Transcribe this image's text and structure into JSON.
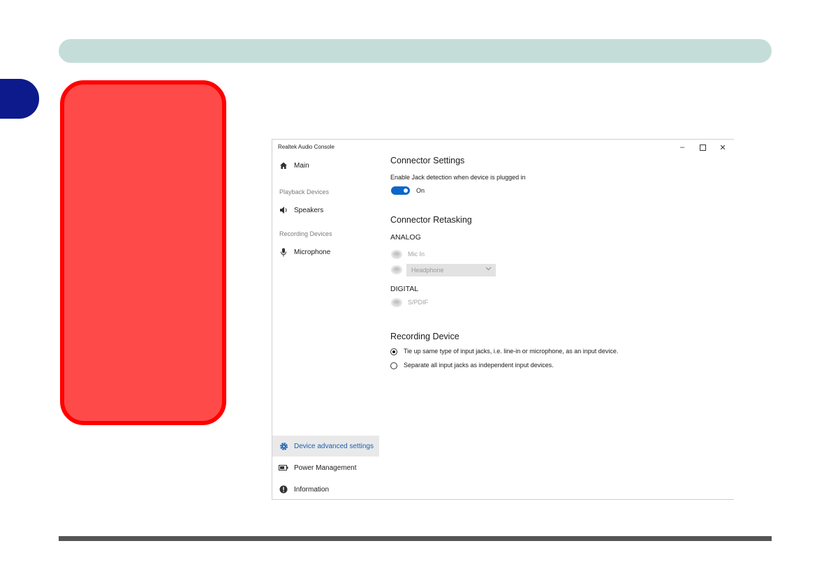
{
  "page": {
    "chapter_tab": ""
  },
  "window": {
    "title": "Realtek Audio Console",
    "controls": {
      "minimize": "–",
      "close": "✕"
    }
  },
  "sidebar": {
    "items": [
      {
        "label": "Main",
        "icon": "home-icon"
      },
      {
        "label": "Speakers",
        "icon": "speaker-icon"
      },
      {
        "label": "Microphone",
        "icon": "microphone-icon"
      },
      {
        "label": "Device advanced settings",
        "icon": "gear-icon",
        "active": true
      },
      {
        "label": "Power Management",
        "icon": "battery-icon"
      },
      {
        "label": "Information",
        "icon": "info-icon"
      }
    ],
    "headings": {
      "playback": "Playback Devices",
      "recording": "Recording Devices"
    }
  },
  "main": {
    "connector_settings": {
      "title": "Connector Settings",
      "jack_detection_label": "Enable Jack detection when device is plugged in",
      "toggle_state": "On"
    },
    "connector_retasking": {
      "title": "Connector Retasking",
      "analog_label": "ANALOG",
      "mic_in_label": "Mic In",
      "headphone_value": "Headphone",
      "digital_label": "DIGITAL",
      "spdif_label": "S/PDIF"
    },
    "recording_device": {
      "title": "Recording Device",
      "option_tie": "Tie up same type of input jacks, i.e. line-in or microphone, as an input device.",
      "option_separate": "Separate all input jacks as independent input devices.",
      "selected": "tie"
    }
  },
  "colors": {
    "header_bar": "#c5ddd8",
    "chapter_tab": "#0d1a8c",
    "side_note_fill": "#ff4a4a",
    "side_note_border": "#ff0000",
    "accent": "#0b67c9"
  }
}
